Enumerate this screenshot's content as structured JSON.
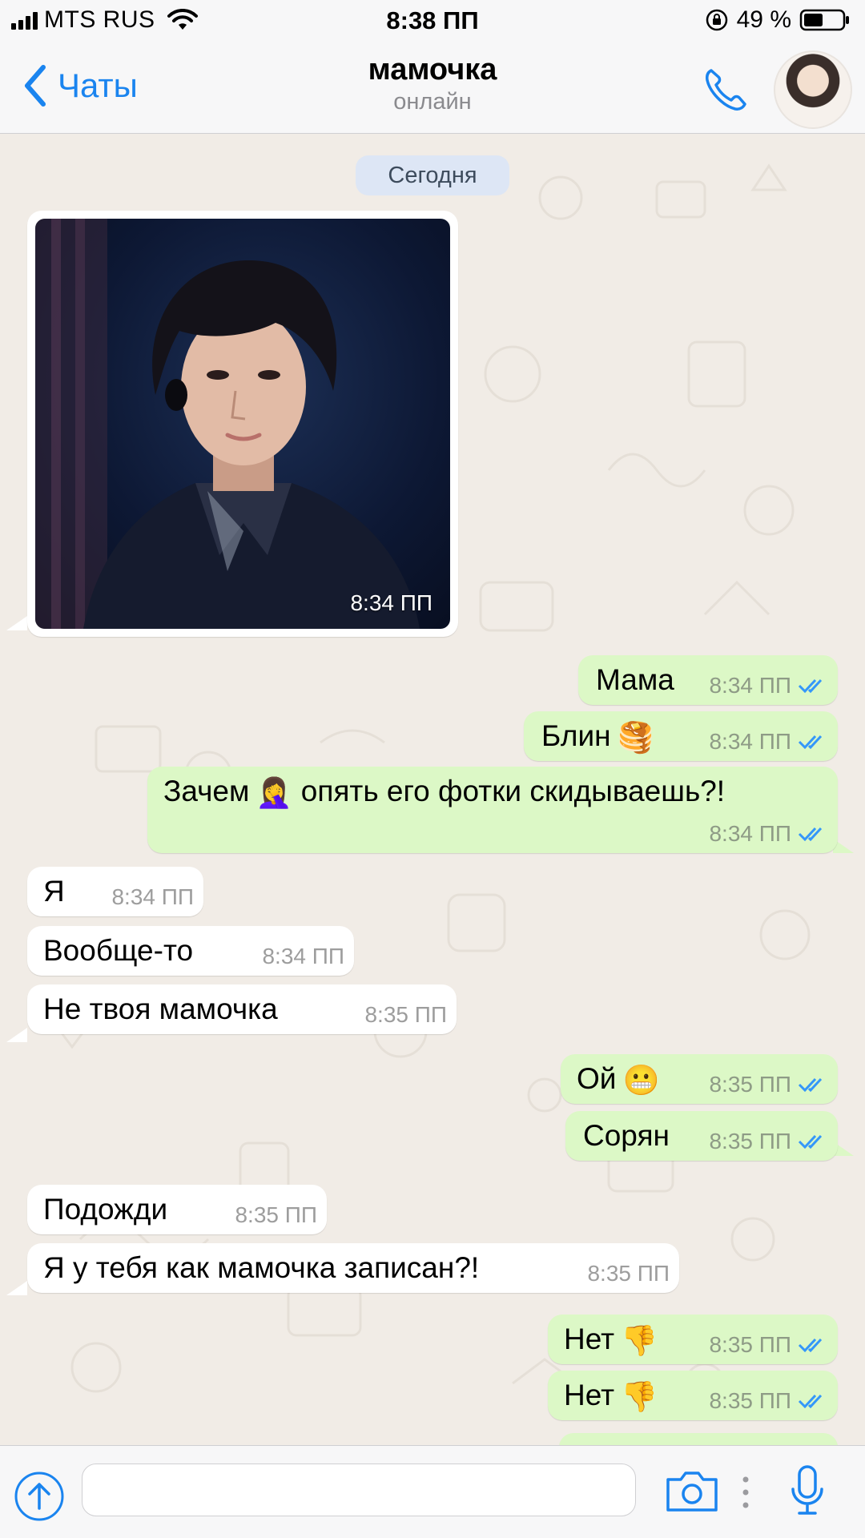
{
  "status_bar": {
    "carrier": "MTS RUS",
    "time": "8:38 ПП",
    "battery_percent": "49 %",
    "battery_level": 0.49,
    "icons": [
      "signal-bars-icon",
      "wifi-icon",
      "orientation-lock-icon",
      "battery-icon"
    ]
  },
  "nav": {
    "back_label": "Чаты",
    "contact_name": "мамочка",
    "contact_status": "онлайн",
    "icons": [
      "chevron-left-icon",
      "phone-icon",
      "contact-avatar"
    ]
  },
  "chat": {
    "date_chip": "Сегодня",
    "photo_message": {
      "time": "8:34 ПП",
      "direction": "in"
    },
    "messages": [
      {
        "text": "Мама",
        "time": "8:34 ПП",
        "direction": "out",
        "status": "read"
      },
      {
        "text": "Блин",
        "emoji": "🥞",
        "time": "8:34 ПП",
        "direction": "out",
        "status": "read"
      },
      {
        "text": "Зачем",
        "emoji": "🤦‍♀️",
        "text_after": "опять его фотки скидываешь?!",
        "time": "8:34 ПП",
        "direction": "out",
        "status": "read"
      },
      {
        "text": "Я",
        "time": "8:34 ПП",
        "direction": "in"
      },
      {
        "text": "Вообще-то",
        "time": "8:34 ПП",
        "direction": "in"
      },
      {
        "text": "Не твоя мамочка",
        "time": "8:35 ПП",
        "direction": "in"
      },
      {
        "text": "Ой",
        "emoji": "😬",
        "time": "8:35 ПП",
        "direction": "out",
        "status": "read"
      },
      {
        "text": "Сорян",
        "time": "8:35 ПП",
        "direction": "out",
        "status": "read"
      },
      {
        "text": "Подожди",
        "time": "8:35 ПП",
        "direction": "in"
      },
      {
        "text": "Я у тебя как мамочка записан?!",
        "time": "8:35 ПП",
        "direction": "in"
      },
      {
        "text": "Нет",
        "emoji": "👎",
        "time": "8:35 ПП",
        "direction": "out",
        "status": "read"
      },
      {
        "text": "Нет",
        "emoji": "👎",
        "time": "8:35 ПП",
        "direction": "out",
        "status": "read"
      }
    ]
  },
  "input_bar": {
    "placeholder": "",
    "icons": [
      "upload-arrow-icon",
      "camera-icon",
      "more-dots-icon",
      "microphone-icon"
    ]
  },
  "colors": {
    "accent": "#1a84ef",
    "outgoing_bubble": "#dcf8c6",
    "incoming_bubble": "#ffffff",
    "chat_background": "#f1ece6",
    "read_ticks": "#3497f9"
  }
}
